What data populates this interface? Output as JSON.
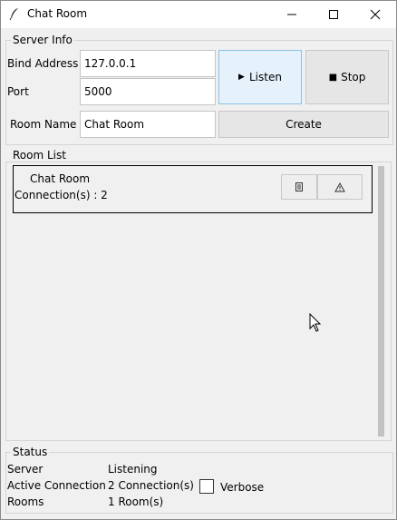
{
  "window": {
    "title": "Chat Room",
    "icon": "feather-icon",
    "controls": [
      "minimize",
      "maximize",
      "close"
    ]
  },
  "server_info": {
    "legend": "Server Info",
    "bind_address_label": "Bind Address",
    "bind_address_value": "127.0.0.1",
    "port_label": "Port",
    "port_value": "5000",
    "room_name_label": "Room Name",
    "room_name_value": "Chat Room",
    "listen_label": "Listen",
    "stop_label": "Stop",
    "create_label": "Create"
  },
  "room_list": {
    "legend": "Room List",
    "rooms": [
      {
        "name": "Chat Room",
        "connections": "Connection(s) : 2"
      }
    ]
  },
  "status": {
    "legend": "Status",
    "server_label": "Server",
    "server_value": "Listening",
    "active_label": "Active Connection",
    "active_value": "2 Connection(s)",
    "rooms_label": "Rooms",
    "rooms_value": "1 Room(s)",
    "verbose_label": "Verbose",
    "verbose_checked": false
  },
  "icons": {
    "listen": "play-icon",
    "stop": "stop-square-icon",
    "room_list": "list-icon",
    "room_warning": "warning-icon"
  }
}
